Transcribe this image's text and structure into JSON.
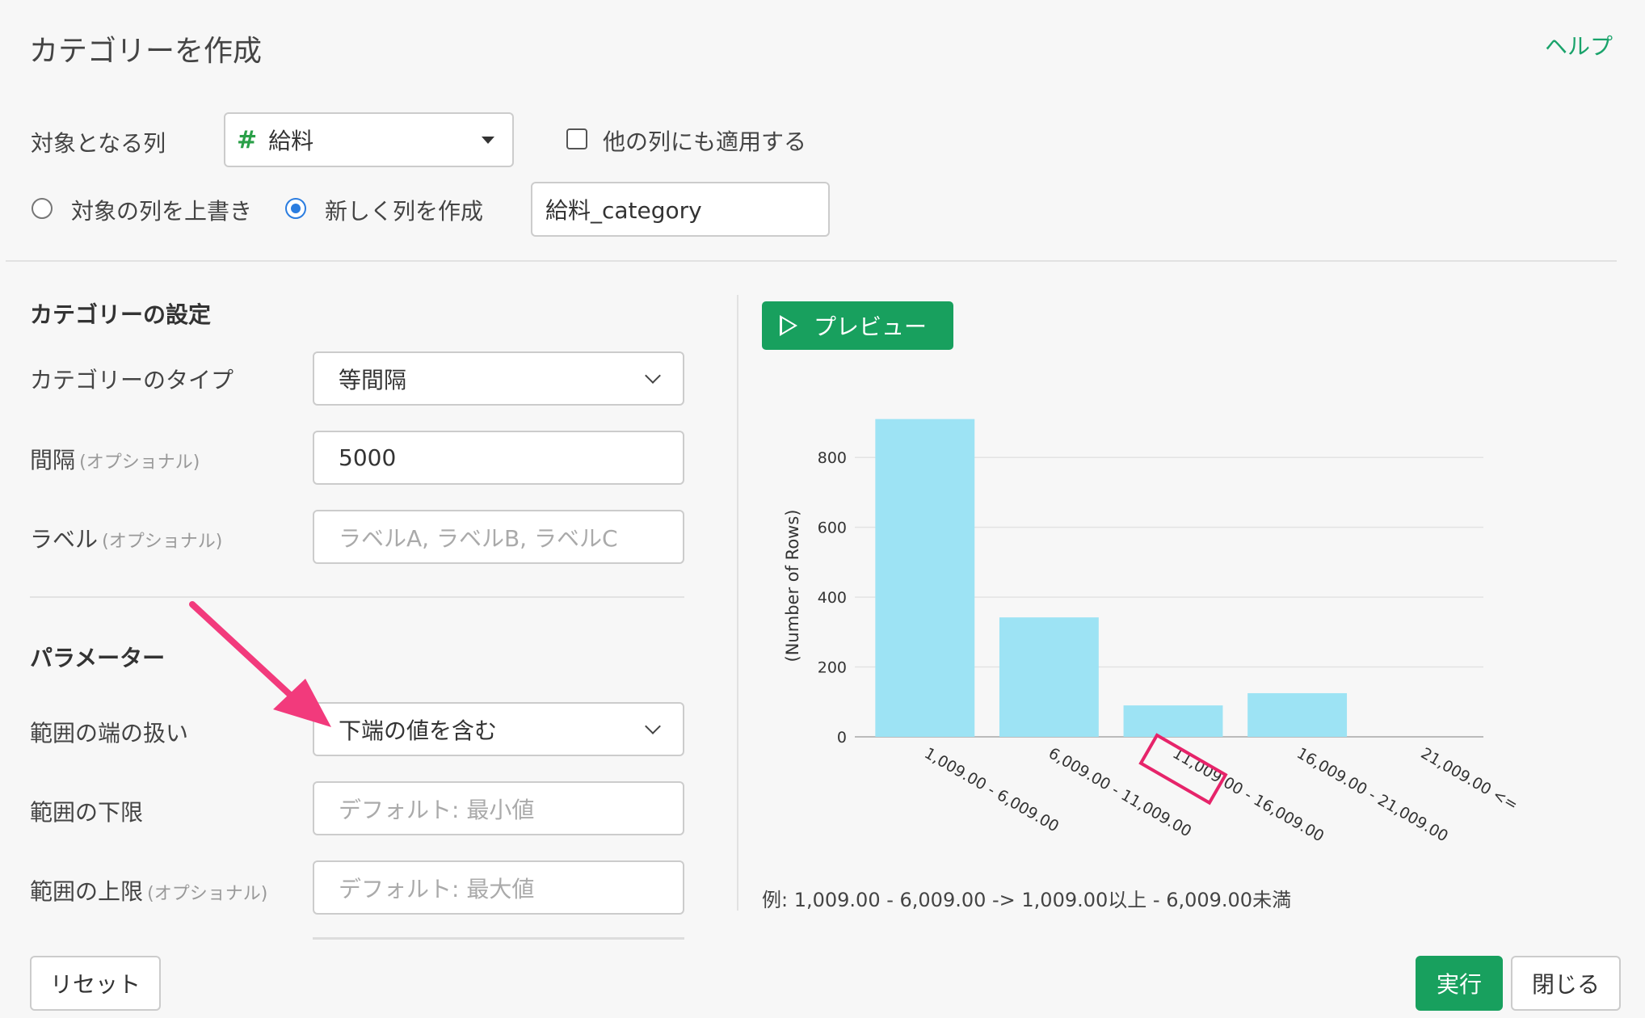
{
  "dialog": {
    "title": "カテゴリーを作成",
    "help": "ヘルプ"
  },
  "target": {
    "label": "対象となる列",
    "column_icon": "#",
    "column_value": "給料",
    "apply_other_label": "他の列にも適用する",
    "overwrite_label": "対象の列を上書き",
    "new_column_label": "新しく列を作成",
    "new_column_name": "給料_category"
  },
  "settings": {
    "section_title": "カテゴリーの設定",
    "type_label": "カテゴリーのタイプ",
    "type_value": "等間隔",
    "interval_label": "間隔",
    "interval_value": "5000",
    "optional": "(オプショナル)",
    "labels_label": "ラベル",
    "labels_placeholder": "ラベルA, ラベルB, ラベルC"
  },
  "params": {
    "section_title": "パラメーター",
    "edge_label": "範囲の端の扱い",
    "edge_value": "下端の値を含む",
    "lower_label": "範囲の下限",
    "lower_placeholder": "デフォルト: 最小値",
    "upper_label": "範囲の上限",
    "upper_placeholder": "デフォルト: 最大値"
  },
  "preview": {
    "button": "プレビュー",
    "example": "例: 1,009.00 - 6,009.00 -> 1,009.00以上 - 6,009.00未満"
  },
  "footer": {
    "reset": "リセット",
    "run": "実行",
    "close": "閉じる"
  },
  "colors": {
    "accent": "#18a05e",
    "bar": "#9de3f4",
    "highlight": "#e6246a"
  },
  "chart_data": {
    "type": "bar",
    "categories": [
      "1,009.00 - 6,009.00",
      "6,009.00 - 11,009.00",
      "11,009.00 - 16,009.00",
      "16,009.00 - 21,009.00",
      "21,009.00 <="
    ],
    "values": [
      910,
      342,
      90,
      125,
      0
    ],
    "ylabel": "(Number of Rows)",
    "yticks": [
      "0",
      "200",
      "400",
      "600",
      "800"
    ],
    "ylim": [
      0,
      930
    ],
    "grid": true
  }
}
